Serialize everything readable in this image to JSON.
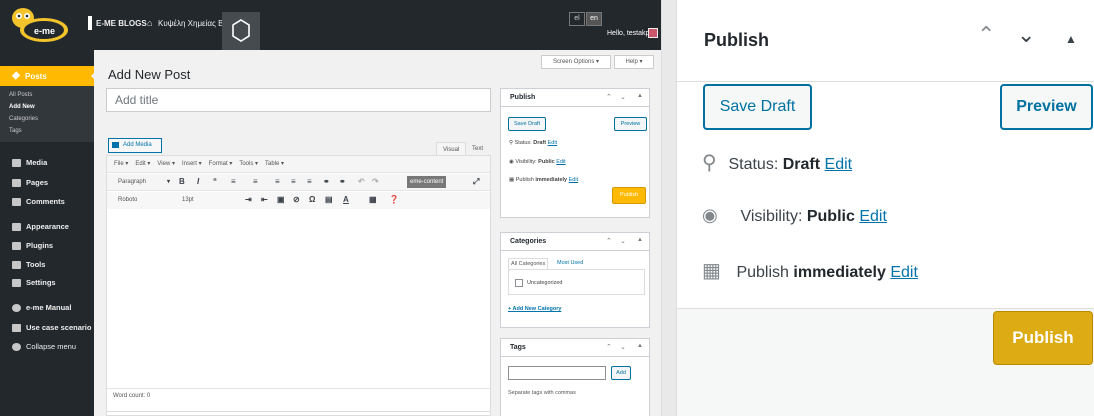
{
  "admin_bar": {
    "site_label": "E-ME BLOGS",
    "blog_label": "Κυψέλη Χημείας Β' ...",
    "lang_el": "el",
    "lang_en": "en",
    "greeting": "Hello, testakp",
    "logo_text": "e-me"
  },
  "sidebar": {
    "posts": "Posts",
    "submenu": [
      "All Posts",
      "Add New",
      "Categories",
      "Tags"
    ],
    "items": [
      "Media",
      "Pages",
      "Comments",
      "Appearance",
      "Plugins",
      "Tools",
      "Settings",
      "e-me Manual",
      "Use case scenario",
      "Collapse menu"
    ]
  },
  "header": {
    "screen_options": "Screen Options ▾",
    "help": "Help ▾",
    "page_title": "Add New Post"
  },
  "editor": {
    "title_placeholder": "Add title",
    "add_media": "Add Media",
    "tab_visual": "Visual",
    "tab_text": "Text",
    "menubar": [
      "File ▾",
      "Edit ▾",
      "View ▾",
      "Insert ▾",
      "Format ▾",
      "Tools ▾",
      "Table ▾"
    ],
    "format_select": "Paragraph",
    "font_select": "Roboto",
    "size_select": "13pt",
    "eme_content": "eme-content",
    "word_count": "Word count: 0"
  },
  "publish_box": {
    "title": "Publish",
    "save_draft": "Save Draft",
    "preview": "Preview",
    "status_label": "Status:",
    "status_value": "Draft",
    "visibility_label": "Visibility:",
    "visibility_value": "Public",
    "publish_label": "Publish",
    "publish_value": "immediately",
    "edit": "Edit",
    "publish_button": "Publish"
  },
  "categories_box": {
    "title": "Categories",
    "tab_all": "All Categories",
    "tab_most_used": "Most Used",
    "item": "Uncategorized",
    "add_new": "+ Add New Category"
  },
  "tags_box": {
    "title": "Tags",
    "add": "Add",
    "hint": "Separate tags with commas"
  },
  "colors": {
    "accent": "#ffb900",
    "link": "#0073aa",
    "admin_dark": "#23282d"
  }
}
